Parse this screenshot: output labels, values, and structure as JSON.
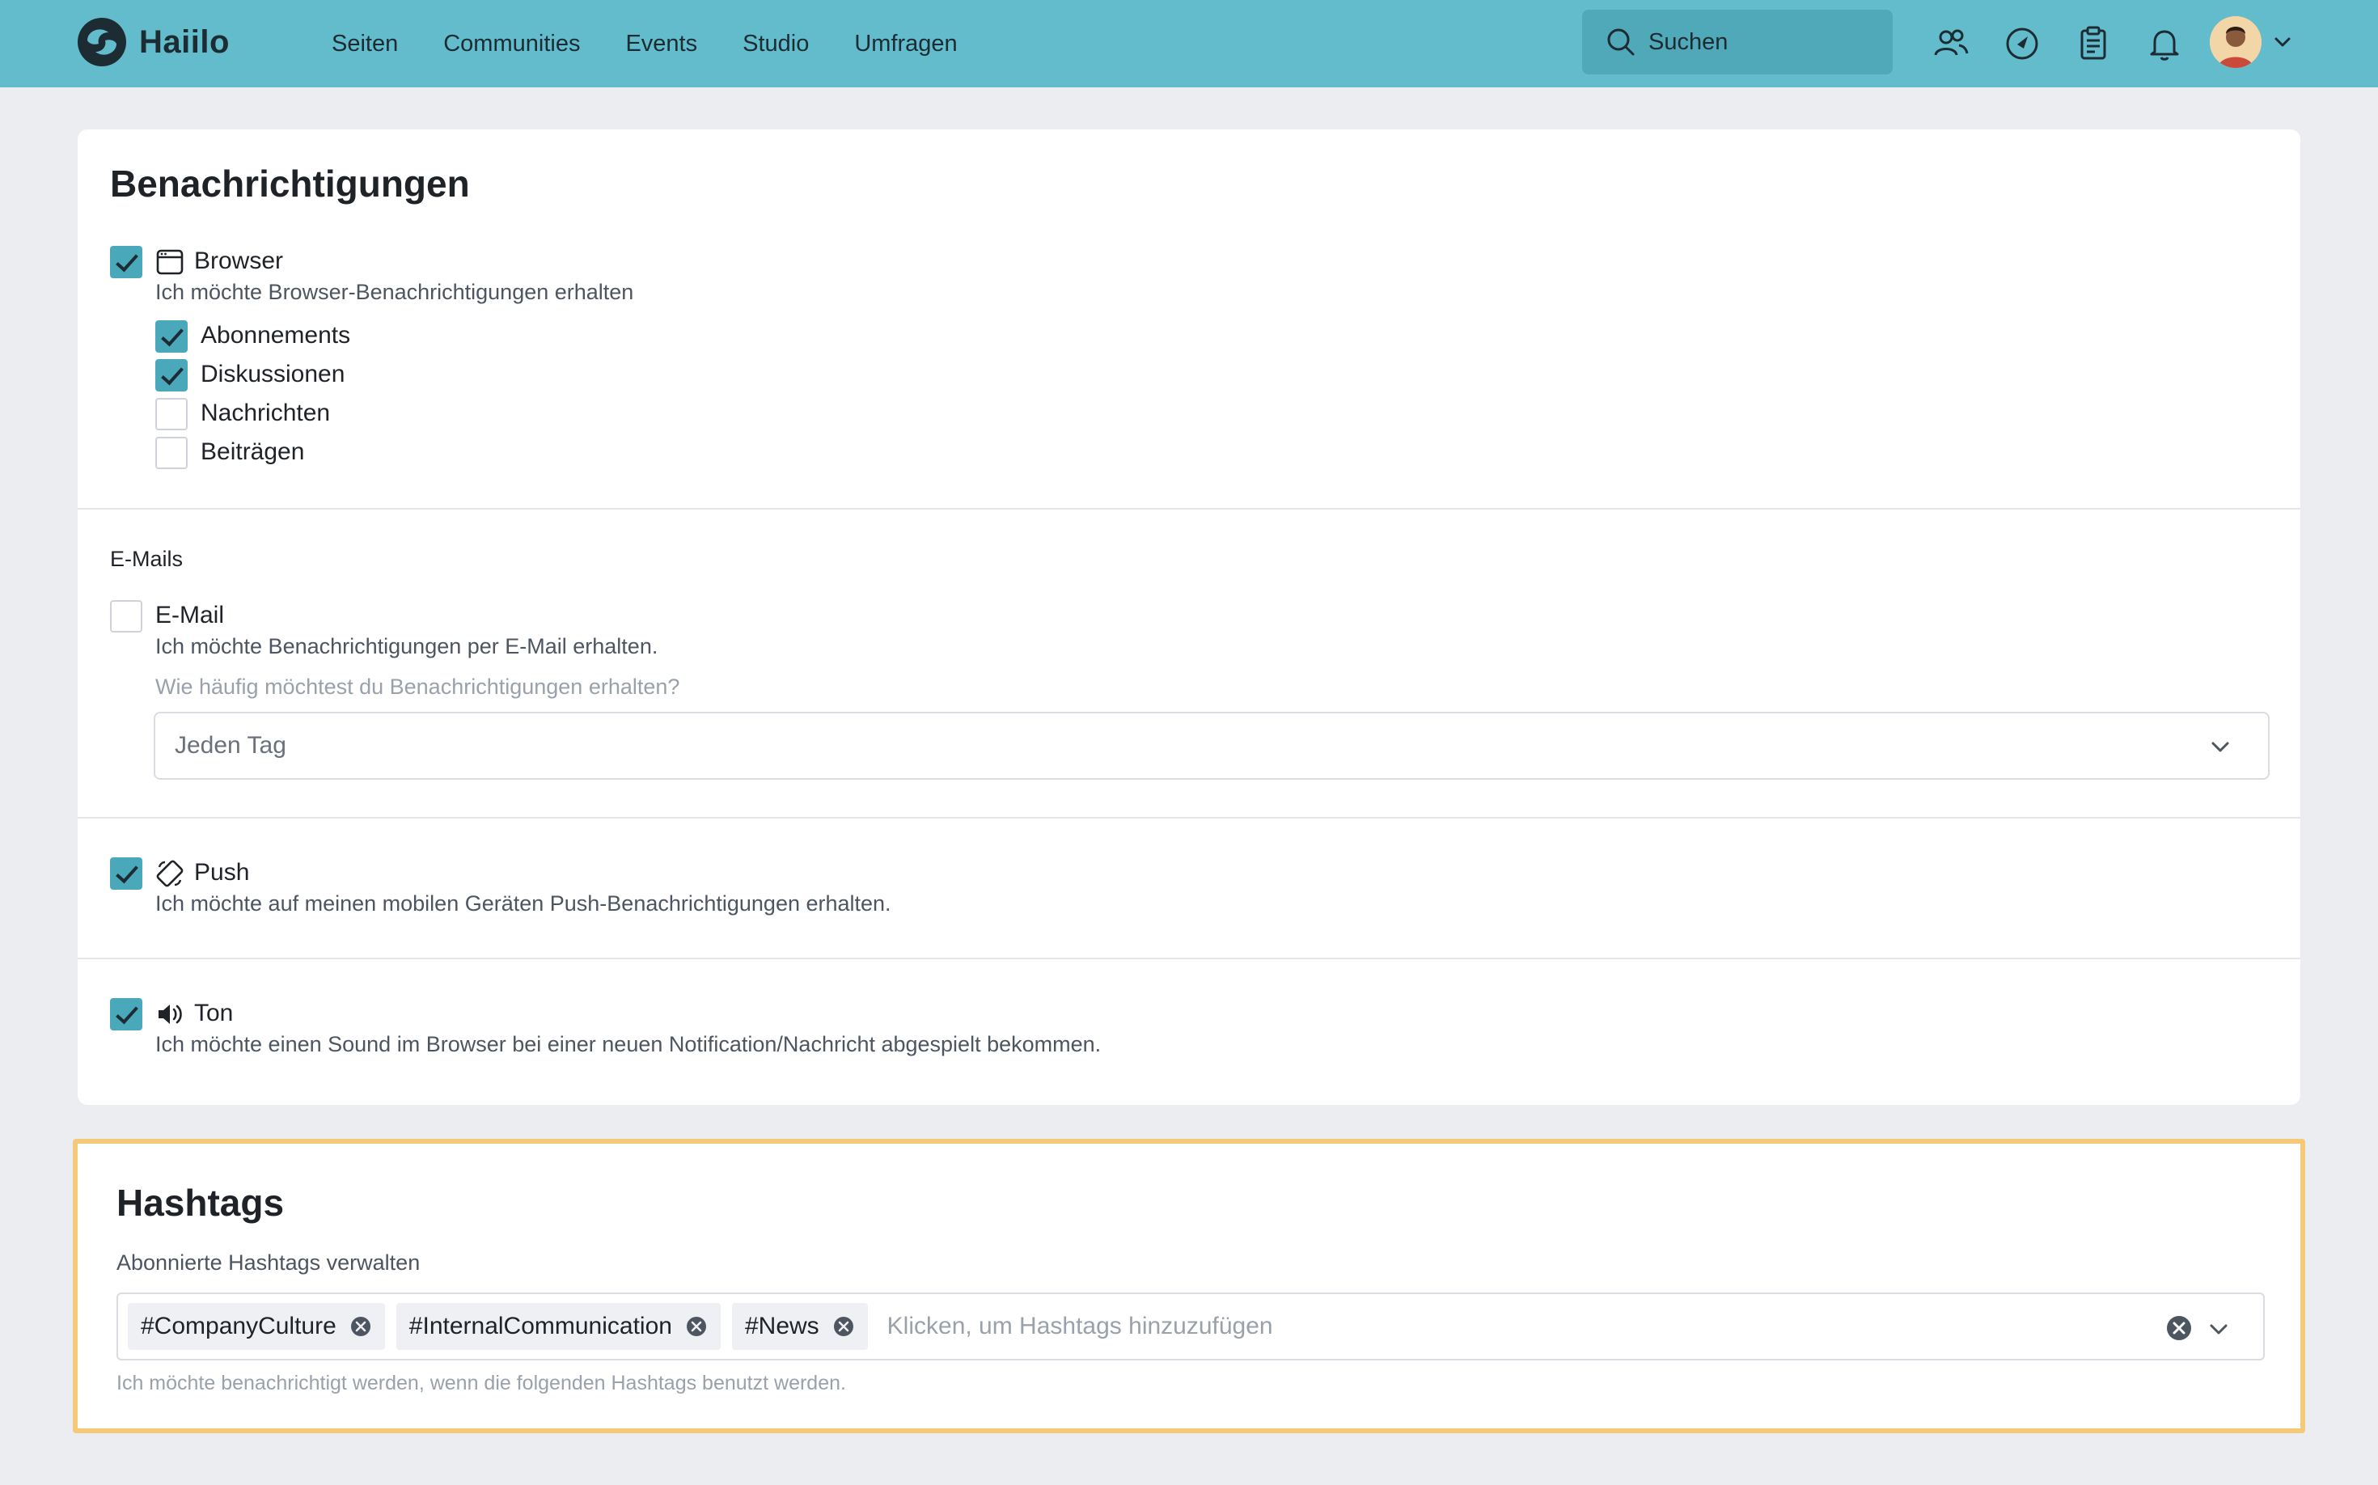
{
  "brand": {
    "name": "Haiilo",
    "color": "#62bccc"
  },
  "nav": {
    "items": [
      {
        "label": "Seiten"
      },
      {
        "label": "Communities"
      },
      {
        "label": "Events"
      },
      {
        "label": "Studio"
      },
      {
        "label": "Umfragen"
      }
    ]
  },
  "search": {
    "placeholder": "Suchen"
  },
  "header_icons": [
    "people-icon",
    "compass-icon",
    "clipboard-icon",
    "bell-icon",
    "avatar",
    "chevron-down-icon"
  ],
  "notifications": {
    "title": "Benachrichtigungen",
    "browser": {
      "label": "Browser",
      "checked": true,
      "icon": "browser-window-icon",
      "description": "Ich möchte Browser-Benachrichtigungen erhalten",
      "options": [
        {
          "label": "Abonnements",
          "checked": true
        },
        {
          "label": "Diskussionen",
          "checked": true
        },
        {
          "label": "Nachrichten",
          "checked": false
        },
        {
          "label": "Beiträgen",
          "checked": false
        }
      ]
    },
    "emails": {
      "section_label": "E-Mails",
      "label": "E-Mail",
      "checked": false,
      "description": "Ich möchte Benachrichtigungen per E-Mail erhalten.",
      "frequency_question": "Wie häufig möchtest du Benachrichtigungen erhalten?",
      "frequency_value": "Jeden Tag"
    },
    "push": {
      "label": "Push",
      "checked": true,
      "icon": "mobile-push-icon",
      "description": "Ich möchte auf meinen mobilen Geräten Push-Benachrichtigungen erhalten."
    },
    "sound": {
      "label": "Ton",
      "checked": true,
      "icon": "speaker-icon",
      "description": "Ich möchte einen Sound im Browser bei einer neuen Notification/Nachricht abgespielt bekommen."
    }
  },
  "hashtags": {
    "title": "Hashtags",
    "manage_label": "Abonnierte Hashtags verwalten",
    "tags": [
      {
        "label": "#CompanyCulture"
      },
      {
        "label": "#InternalCommunication"
      },
      {
        "label": "#News"
      }
    ],
    "placeholder": "Klicken, um Hashtags hinzuzufügen",
    "hint": "Ich möchte benachrichtigt werden, wenn die folgenden Hashtags benutzt werden.",
    "highlight_color": "#f5c978"
  },
  "colors": {
    "accent": "#49a9bb",
    "background": "#ecedf1"
  }
}
